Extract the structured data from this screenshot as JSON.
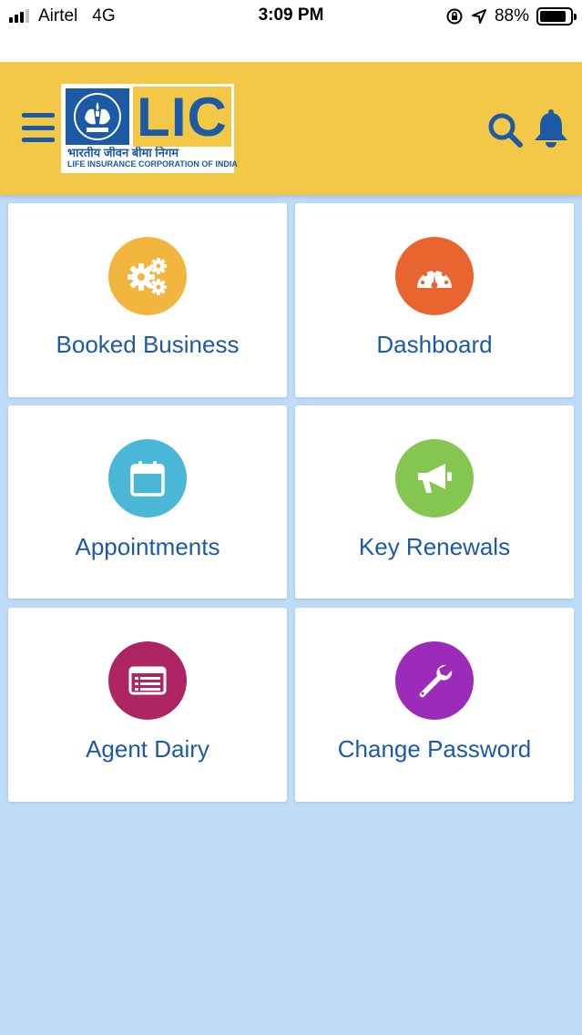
{
  "status_bar": {
    "carrier": "Airtel",
    "network": "4G",
    "time": "3:09 PM",
    "battery_percent": "88%",
    "battery_level": 0.88,
    "signal_bars_active": 3,
    "signal_bars_total": 4
  },
  "header": {
    "logo": {
      "text": "LIC",
      "hindi": "भारतीय जीवन बीमा निगम",
      "english": "LIFE INSURANCE CORPORATION OF INDIA"
    },
    "icons": [
      "menu-icon",
      "search-icon",
      "bell-icon"
    ]
  },
  "tiles": [
    {
      "label": "Booked Business",
      "icon": "gears-icon",
      "color": "#f2b63f"
    },
    {
      "label": "Dashboard",
      "icon": "dashboard-icon",
      "color": "#e9652f"
    },
    {
      "label": "Appointments",
      "icon": "calendar-icon",
      "color": "#4ab7d6"
    },
    {
      "label": "Key Renewals",
      "icon": "megaphone-icon",
      "color": "#85c650"
    },
    {
      "label": "Agent Dairy",
      "icon": "diary-icon",
      "color": "#ad2663"
    },
    {
      "label": "Change Password",
      "icon": "wrench-icon",
      "color": "#9b2bb8"
    }
  ],
  "colors": {
    "header_bg": "#f3c846",
    "brand_blue": "#1d5aa5",
    "page_bg": "#bedcf8"
  }
}
